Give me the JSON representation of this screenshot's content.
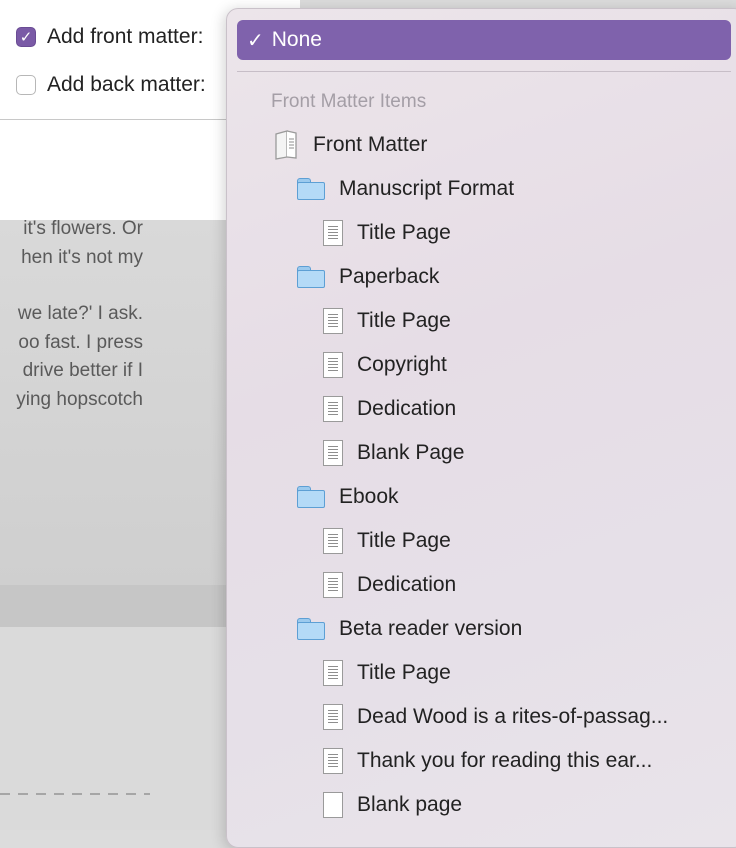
{
  "options": {
    "front_matter": {
      "label": "Add front matter:",
      "checked": true
    },
    "back_matter": {
      "label": "Add back matter:",
      "checked": false
    }
  },
  "document": {
    "lines": [
      "it's flowers. Or",
      "hen it's not my",
      "",
      "we late?' I ask.",
      "oo fast. I press",
      "drive better if I",
      "ying hopscotch"
    ]
  },
  "menu": {
    "selected": {
      "label": "None",
      "check_glyph": "✓"
    },
    "heading": "Front Matter Items",
    "items": [
      {
        "label": "Front Matter",
        "icon": "front-matter-icon"
      },
      {
        "label": "Manuscript Format",
        "icon": "folder-icon"
      },
      {
        "label": "Title Page",
        "icon": "document-icon"
      },
      {
        "label": "Paperback",
        "icon": "folder-icon"
      },
      {
        "label": "Title Page",
        "icon": "document-icon"
      },
      {
        "label": "Copyright",
        "icon": "document-icon"
      },
      {
        "label": "Dedication",
        "icon": "document-icon"
      },
      {
        "label": "Blank Page",
        "icon": "document-icon"
      },
      {
        "label": "Ebook",
        "icon": "folder-icon"
      },
      {
        "label": "Title Page",
        "icon": "document-icon"
      },
      {
        "label": "Dedication",
        "icon": "document-icon"
      },
      {
        "label": "Beta reader version",
        "icon": "folder-icon"
      },
      {
        "label": "Title Page",
        "icon": "document-icon"
      },
      {
        "label": "Dead Wood is a rites-of-passag...",
        "icon": "document-icon"
      },
      {
        "label": "Thank you for reading this ear...",
        "icon": "document-icon"
      },
      {
        "label": "Blank page",
        "icon": "blank-document-icon"
      }
    ]
  },
  "colors": {
    "accent": "#7f62ac",
    "checkbox_checked": "#7a5aa6",
    "folder": "#b4daf7"
  }
}
